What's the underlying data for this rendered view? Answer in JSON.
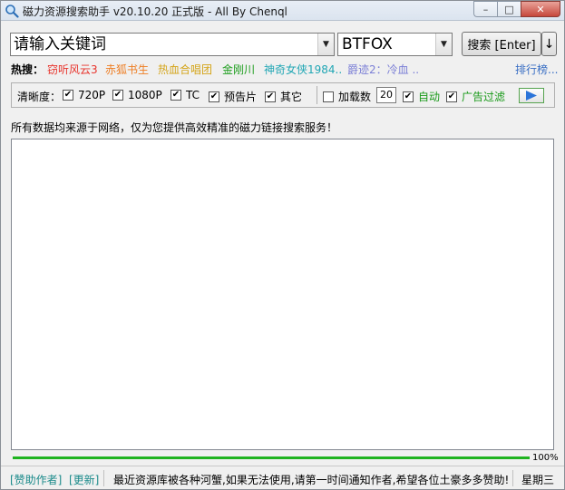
{
  "window": {
    "title": "磁力资源搜索助手 v20.10.20 正式版 - All By Chenql"
  },
  "search": {
    "placeholder": "请输入关键词",
    "engine": "BTFOX",
    "button_label": "搜索 [Enter]",
    "more_label": "↓"
  },
  "hot": {
    "label": "热搜：",
    "items": [
      {
        "text": "窃听风云3",
        "color": "#e8342c"
      },
      {
        "text": "赤狐书生",
        "color": "#ee7d22"
      },
      {
        "text": "热血合唱团",
        "color": "#d4a418"
      },
      {
        "text": "金刚川",
        "color": "#1e9e1e"
      },
      {
        "text": "神奇女侠1984..",
        "color": "#20a6b4"
      },
      {
        "text": "爵迹2：冷血 ..",
        "color": "#7b7fd6"
      }
    ],
    "rank_label": "排行榜..."
  },
  "options": {
    "clarity_label": "清晰度：",
    "clarity": [
      {
        "label": "720P",
        "checked": true
      },
      {
        "label": "1080P",
        "checked": true
      },
      {
        "label": "TC",
        "checked": true
      },
      {
        "label": "预告片",
        "checked": true
      },
      {
        "label": "其它",
        "checked": true
      }
    ],
    "load_count": {
      "label": "加载数",
      "checked": false,
      "value": "20"
    },
    "auto": {
      "label": "自动",
      "checked": true
    },
    "ad_filter": {
      "label": "广告过滤",
      "checked": true
    }
  },
  "notice": "所有数据均来源于网络，仅为您提供高效精准的磁力链接搜索服务！",
  "progress": {
    "percent": 100,
    "label": "100%"
  },
  "status": {
    "sponsor": "[赞助作者]",
    "update": "[更新]",
    "message": "最近资源库被各种河蟹,如果无法使用,请第一时间通知作者,希望各位土豪多多赞助!",
    "weekday": "星期三"
  },
  "colors": {
    "accent_green": "#1fb31f",
    "link_blue": "#3a6fc4",
    "status_teal": "#1a8a8a",
    "close_red": "#c6473b"
  },
  "icons": {
    "app": "magnifier-icon",
    "play": "play-icon",
    "check": "checkmark-icon",
    "dropdown": "chevron-down-icon"
  }
}
